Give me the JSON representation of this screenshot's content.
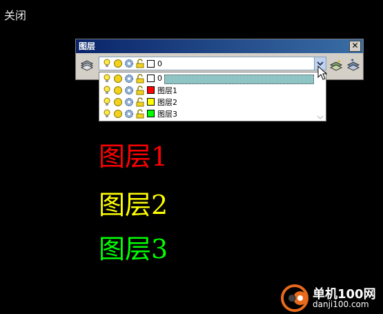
{
  "app": {
    "close_label": "关闭"
  },
  "toolbar": {
    "title": "图层",
    "close_glyph": "✕",
    "current_layer": "0"
  },
  "dropdown": {
    "items": [
      {
        "name": "0",
        "color": "#ffffff"
      },
      {
        "name": "图层1",
        "color": "#ff0000"
      },
      {
        "name": "图层2",
        "color": "#ffff00"
      },
      {
        "name": "图层3",
        "color": "#00ff00"
      }
    ]
  },
  "canvas": {
    "labels": [
      {
        "text": "图层1",
        "color": "#ff0000"
      },
      {
        "text": "图层2",
        "color": "#ffff00"
      },
      {
        "text": "图层3",
        "color": "#00ff00"
      }
    ]
  },
  "watermark": {
    "line1": "单机100网",
    "line2": "danji100.com"
  },
  "icons": [
    "bulb-icon",
    "sun-icon",
    "gear-icon",
    "lock-icon",
    "layer-stack-icon",
    "chevron-down-icon"
  ]
}
